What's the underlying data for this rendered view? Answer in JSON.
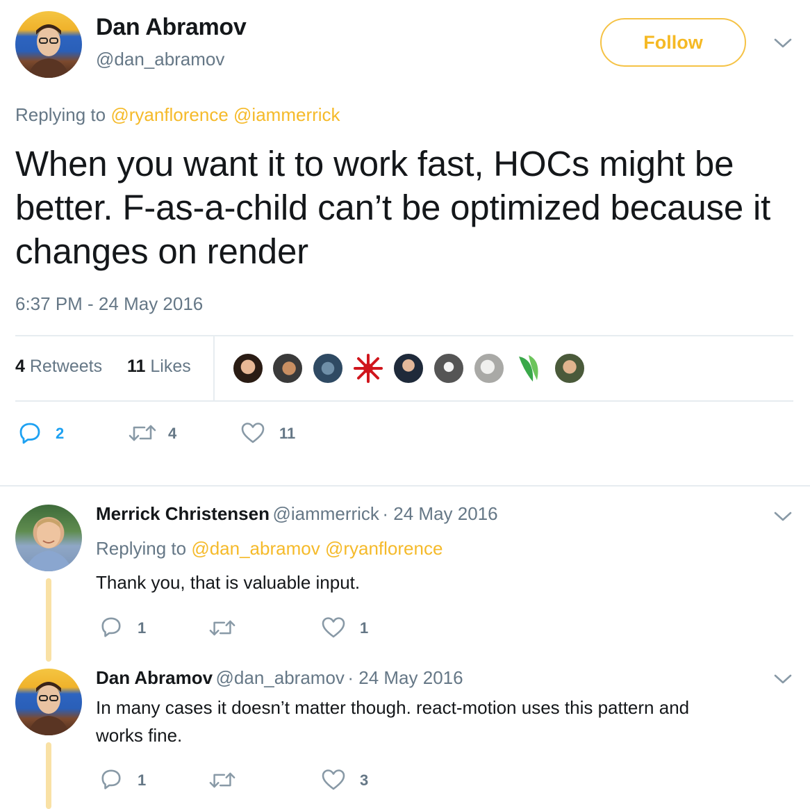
{
  "main_tweet": {
    "author_name": "Dan Abramov",
    "author_handle": "@dan_abramov",
    "follow_label": "Follow",
    "replying_prefix": "Replying to",
    "replying_to": [
      "@ryanflorence",
      "@iammerrick"
    ],
    "text": "When you want it to work fast, HOCs might be better. F-as-a-child can’t be optimized because it changes on render",
    "timestamp": "6:37 PM - 24 May 2016",
    "retweets_count": "4",
    "retweets_label": "Retweets",
    "likes_count": "11",
    "likes_label": "Likes",
    "actions": {
      "replies": "2",
      "retweets": "4",
      "likes": "11"
    }
  },
  "replies": [
    {
      "author_name": "Merrick Christensen",
      "author_handle": "@iammerrick",
      "date": "· 24 May 2016",
      "replying_prefix": "Replying to",
      "replying_to": [
        "@dan_abramov",
        "@ryanflorence"
      ],
      "text": "Thank you, that is valuable input.",
      "actions": {
        "replies": "1",
        "retweets": "",
        "likes": "1"
      }
    },
    {
      "author_name": "Dan Abramov",
      "author_handle": "@dan_abramov",
      "date": "· 24 May 2016",
      "text_line1": "In many cases it doesn’t matter though. react-motion uses this pattern and",
      "text_line2": "works fine.",
      "actions": {
        "replies": "1",
        "retweets": "",
        "likes": "3"
      }
    }
  ],
  "colors": {
    "accent": "#f5ba2a",
    "reply_blue": "#1da1f2",
    "muted": "#657786",
    "text": "#14171a",
    "divider": "#e6ecf0"
  }
}
